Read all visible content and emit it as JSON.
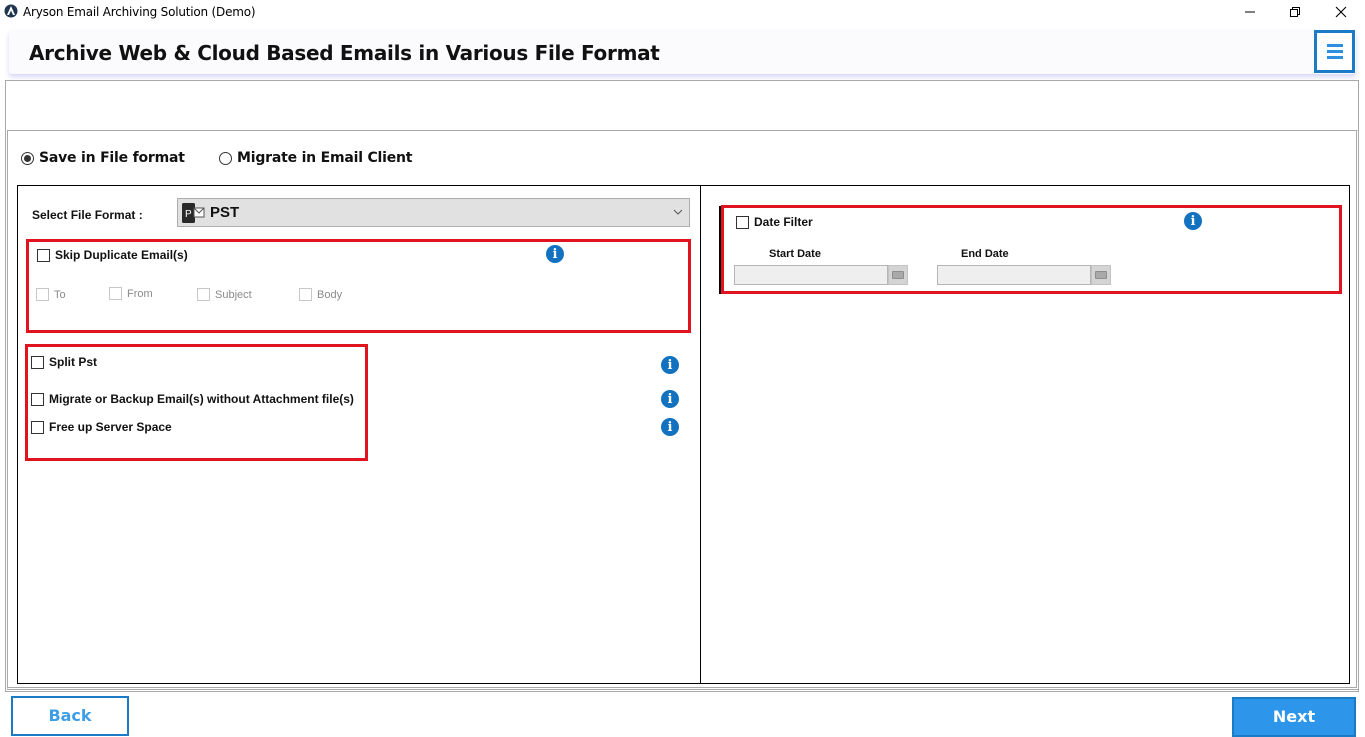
{
  "window": {
    "title": "Aryson Email Archiving Solution (Demo)",
    "controls": [
      "minimize",
      "restore",
      "close"
    ]
  },
  "header": {
    "title": "Archive Web & Cloud Based Emails in Various File Format",
    "menu_icon": "hamburger-menu-icon"
  },
  "mode": {
    "options": [
      {
        "label": "Save in File format",
        "selected": true
      },
      {
        "label": "Migrate in Email Client",
        "selected": false
      }
    ]
  },
  "left": {
    "format_label": "Select File Format  :",
    "format_value": "PST",
    "skip_duplicate": {
      "label": "Skip Duplicate Email(s)",
      "checked": false,
      "criteria": [
        {
          "label": "To",
          "checked": false,
          "enabled": false
        },
        {
          "label": "From",
          "checked": false,
          "enabled": false
        },
        {
          "label": "Subject",
          "checked": false,
          "enabled": false
        },
        {
          "label": "Body",
          "checked": false,
          "enabled": false
        }
      ]
    },
    "options": [
      {
        "label": "Split Pst",
        "checked": false
      },
      {
        "label": "Migrate or Backup Email(s) without Attachment file(s)",
        "checked": false
      },
      {
        "label": "Free up Server Space",
        "checked": false
      }
    ]
  },
  "right": {
    "date_filter": {
      "label": "Date Filter",
      "checked": false,
      "start_label": "Start Date",
      "end_label": "End Date",
      "start_value": "",
      "end_value": ""
    }
  },
  "footer": {
    "back_label": "Back",
    "next_label": "Next"
  },
  "colors": {
    "accent": "#1a7bc6",
    "highlight_border": "#e0141e",
    "info_icon": "#1272c0"
  }
}
